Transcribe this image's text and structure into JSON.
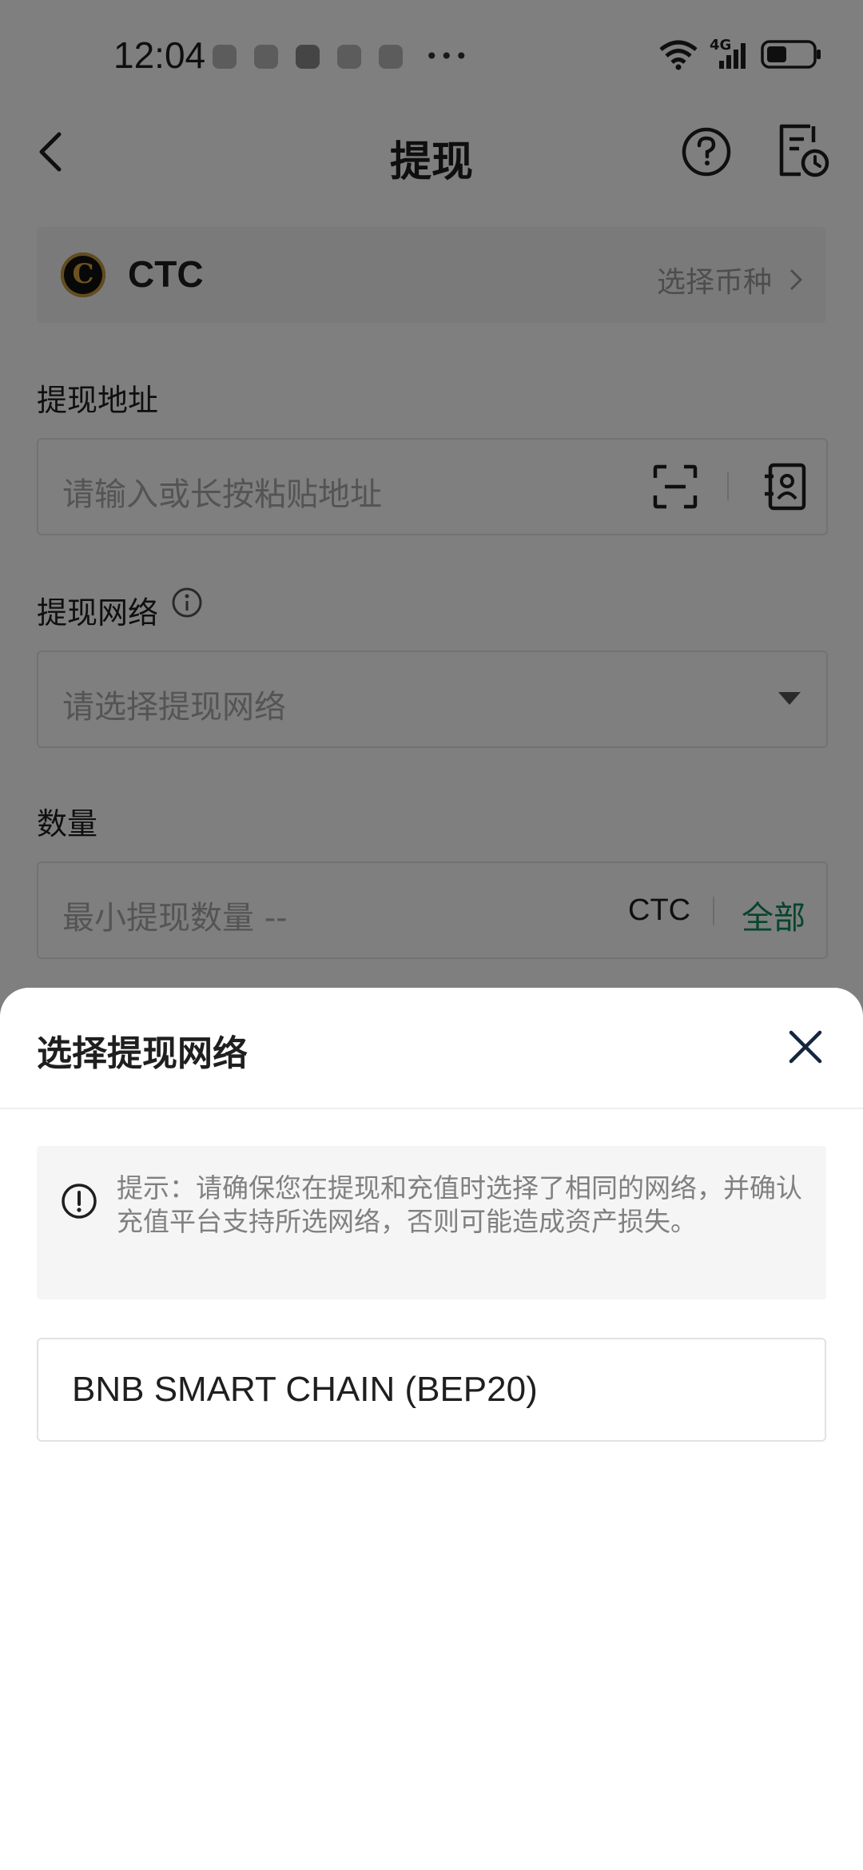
{
  "status_bar": {
    "time": "12:04",
    "network_type": "4G"
  },
  "header": {
    "title": "提现"
  },
  "coin": {
    "symbol": "CTC",
    "select_label": "选择币种",
    "logo_letter": "C"
  },
  "address": {
    "label": "提现地址",
    "placeholder": "请输入或长按粘贴地址"
  },
  "network": {
    "label": "提现网络",
    "placeholder": "请选择提现网络"
  },
  "amount": {
    "label": "数量",
    "placeholder": "最小提现数量 --",
    "unit": "CTC",
    "all_label": "全部"
  },
  "sheet": {
    "title": "选择提现网络",
    "notice": "提示：请确保您在提现和充值时选择了相同的网络，并确认充值平台支持所选网络，否则可能造成资产损失。",
    "options": [
      {
        "label": "BNB SMART CHAIN (BEP20)"
      }
    ]
  },
  "colors": {
    "accent_green": "#0d8a5a",
    "overlay": "rgba(0,0,0,0.5)"
  }
}
